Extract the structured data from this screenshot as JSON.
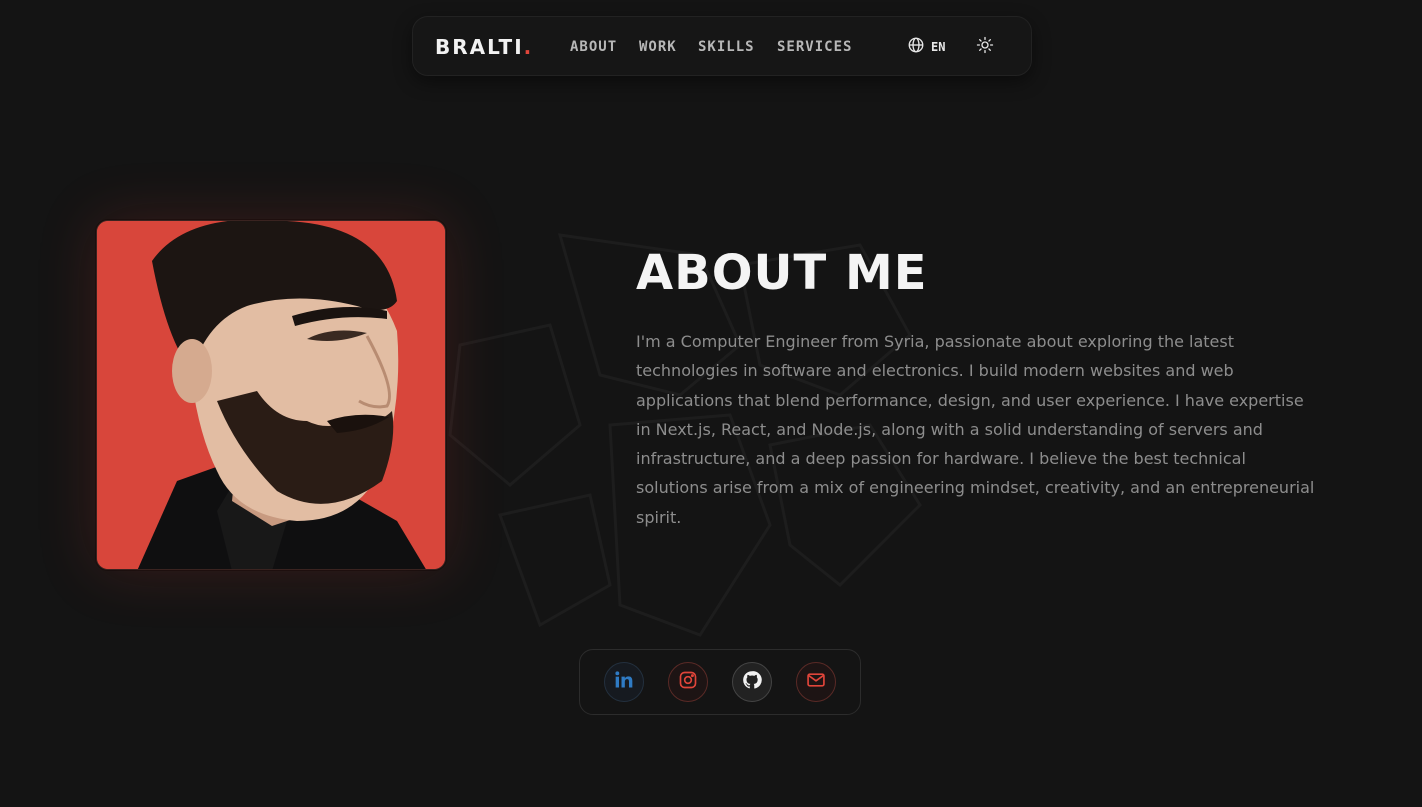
{
  "nav": {
    "logo_text": "BRALTI",
    "logo_dot": ".",
    "links": [
      {
        "label": "ABOUT"
      },
      {
        "label": "WORK"
      },
      {
        "label": "SKILLS"
      },
      {
        "label": "SERVICES"
      }
    ],
    "language": {
      "icon": "globe-icon",
      "label": "EN"
    },
    "theme_toggle": {
      "icon": "sun-icon"
    }
  },
  "about": {
    "title": "ABOUT ME",
    "body": "I'm a Computer Engineer from Syria, passionate about exploring the latest technologies in software and electronics. I build modern websites and web applications that blend performance, design, and user experience. I have expertise in Next.js, React, and Node.js, along with a solid understanding of servers and infrastructure, and a deep passion for hardware. I believe the best technical solutions arise from a mix of engineering mindset, creativity, and an entrepreneurial spirit."
  },
  "photo": {
    "description_icon": "profile-photo"
  },
  "social": [
    {
      "name": "linkedin",
      "icon": "linkedin-icon",
      "color": "#2f7bc4"
    },
    {
      "name": "instagram",
      "icon": "instagram-icon",
      "color": "#e0453a"
    },
    {
      "name": "github",
      "icon": "github-icon",
      "color": "#f2f2f2"
    },
    {
      "name": "email",
      "icon": "mail-icon",
      "color": "#e0453a"
    }
  ],
  "colors": {
    "background": "#141414",
    "accent": "#e0453a",
    "text_primary": "#f4f4f4",
    "text_muted": "#8d8d8d"
  }
}
